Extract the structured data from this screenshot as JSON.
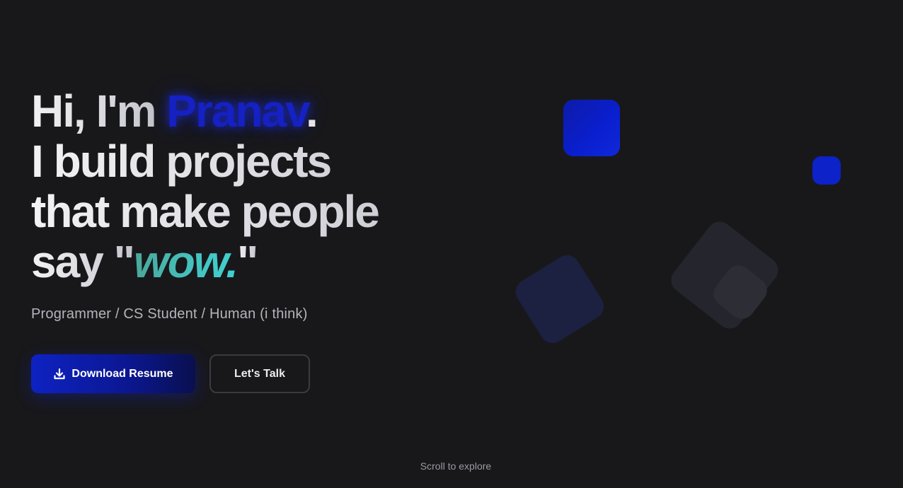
{
  "hero": {
    "greeting": "Hi, I'm",
    "name": "Pranav",
    "name_suffix": ".",
    "line2": "I build projects",
    "line3": "that make people",
    "line4_prefix": "say \"",
    "highlight": "wow.",
    "line4_suffix": "\"",
    "subtitle": "Programmer / CS Student / Human (i think)"
  },
  "actions": {
    "download_label": "Download Resume",
    "download_icon": "download-icon",
    "contact_label": "Let's Talk"
  },
  "footer": {
    "scroll_hint": "Scroll to explore"
  },
  "colors": {
    "background": "#18181b",
    "accent_blue": "#0e22c2",
    "accent_teal": "#45c3c0",
    "text_primary": "#e8e8ec",
    "text_secondary": "#b4b4bc"
  }
}
